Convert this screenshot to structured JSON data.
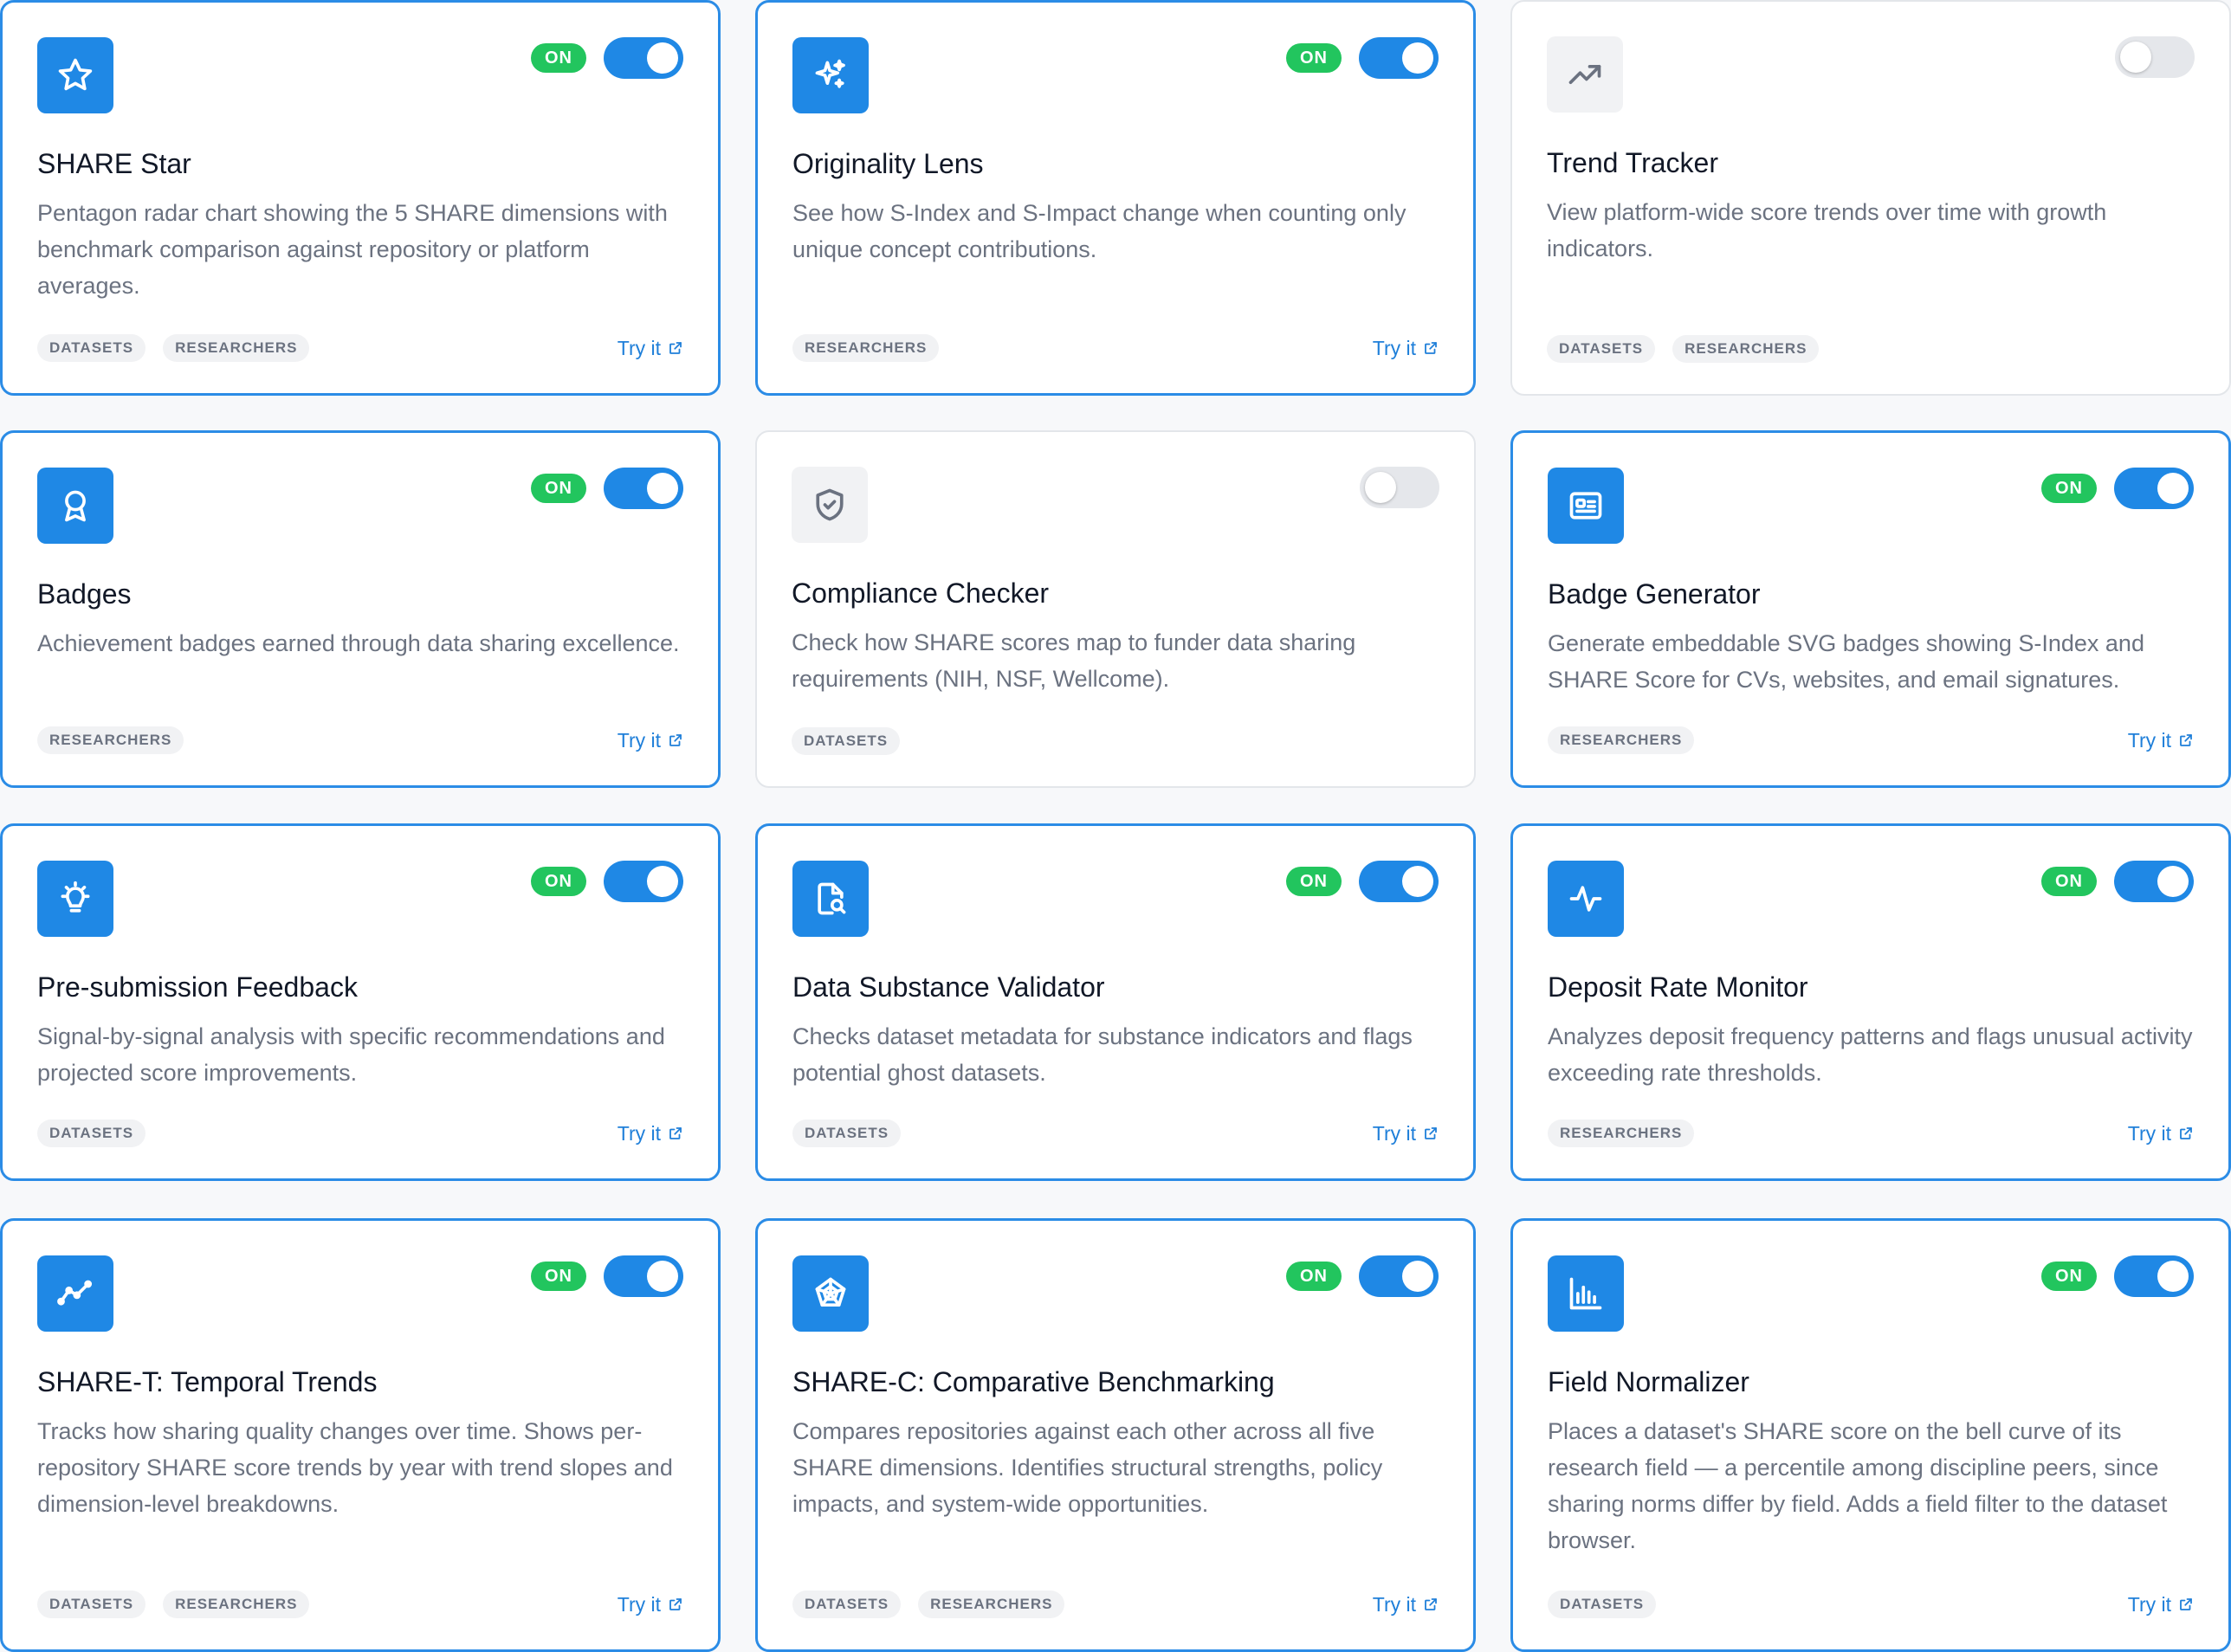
{
  "colors": {
    "accent": "#1f88e5",
    "card_border_on": "#2b8ce6",
    "card_border_off": "#e3e6ea",
    "on_badge": "#22c55e",
    "tag_bg": "#f1f2f4",
    "link": "#1f7fd9"
  },
  "try_label": "Try it",
  "cards": [
    {
      "title": "SHARE Star",
      "enabled": true,
      "on_label": "ON",
      "icon": "star-icon",
      "description": "Pentagon radar chart showing the 5 SHARE dimensions with benchmark comparison against repository or platform averages.",
      "tags": [
        "DATASETS",
        "RESEARCHERS"
      ],
      "try_it": true
    },
    {
      "title": "Originality Lens",
      "enabled": true,
      "on_label": "ON",
      "icon": "sparkles-icon",
      "description": "See how S-Index and S-Impact change when counting only unique concept contributions.",
      "tags": [
        "RESEARCHERS"
      ],
      "try_it": true
    },
    {
      "title": "Trend Tracker",
      "enabled": false,
      "on_label": "",
      "icon": "trending-up-icon",
      "description": "View platform-wide score trends over time with growth indicators.",
      "tags": [
        "DATASETS",
        "RESEARCHERS"
      ],
      "try_it": false
    },
    {
      "title": "Badges",
      "enabled": true,
      "on_label": "ON",
      "icon": "award-icon",
      "description": "Achievement badges earned through data sharing excellence.",
      "tags": [
        "RESEARCHERS"
      ],
      "try_it": true
    },
    {
      "title": "Compliance Checker",
      "enabled": false,
      "on_label": "",
      "icon": "shield-check-icon",
      "description": "Check how SHARE scores map to funder data sharing requirements (NIH, NSF, Wellcome).",
      "tags": [
        "DATASETS"
      ],
      "try_it": false
    },
    {
      "title": "Badge Generator",
      "enabled": true,
      "on_label": "ON",
      "icon": "id-card-icon",
      "description": "Generate embeddable SVG badges showing S-Index and SHARE Score for CVs, websites, and email signatures.",
      "tags": [
        "RESEARCHERS"
      ],
      "try_it": true
    },
    {
      "title": "Pre-submission Feedback",
      "enabled": true,
      "on_label": "ON",
      "icon": "lightbulb-icon",
      "description": "Signal-by-signal analysis with specific recommendations and projected score improvements.",
      "tags": [
        "DATASETS"
      ],
      "try_it": true
    },
    {
      "title": "Data Substance Validator",
      "enabled": true,
      "on_label": "ON",
      "icon": "file-search-icon",
      "description": "Checks dataset metadata for substance indicators and flags potential ghost datasets.",
      "tags": [
        "DATASETS"
      ],
      "try_it": true
    },
    {
      "title": "Deposit Rate Monitor",
      "enabled": true,
      "on_label": "ON",
      "icon": "activity-icon",
      "description": "Analyzes deposit frequency patterns and flags unusual activity exceeding rate thresholds.",
      "tags": [
        "RESEARCHERS"
      ],
      "try_it": true
    },
    {
      "title": "SHARE-T: Temporal Trends",
      "enabled": true,
      "on_label": "ON",
      "icon": "line-chart-icon",
      "description": "Tracks how sharing quality changes over time. Shows per-repository SHARE score trends by year with trend slopes and dimension-level breakdowns.",
      "tags": [
        "DATASETS",
        "RESEARCHERS"
      ],
      "try_it": true
    },
    {
      "title": "SHARE-C: Comparative Benchmarking",
      "enabled": true,
      "on_label": "ON",
      "icon": "radar-icon",
      "description": "Compares repositories against each other across all five SHARE dimensions. Identifies structural strengths, policy impacts, and system-wide opportunities.",
      "tags": [
        "DATASETS",
        "RESEARCHERS"
      ],
      "try_it": true
    },
    {
      "title": "Field Normalizer",
      "enabled": true,
      "on_label": "ON",
      "icon": "bar-chart-icon",
      "description": "Places a dataset's SHARE score on the bell curve of its research field — a percentile among discipline peers, since sharing norms differ by field. Adds a field filter to the dataset browser.",
      "tags": [
        "DATASETS"
      ],
      "try_it": true
    }
  ]
}
